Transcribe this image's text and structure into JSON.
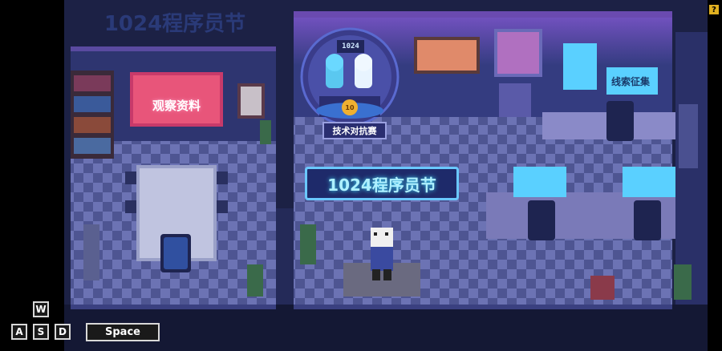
{
  "scene": {
    "top_watermark": "1024程序员节",
    "sign_observe": "观察资料",
    "sign_clues": "线索征集",
    "banner_main": "1024程序员节",
    "sign_tech_battle": "技术对抗赛",
    "trophy_label": "1024",
    "coin_label": "10"
  },
  "controls": {
    "keys": [
      "W",
      "A",
      "S",
      "D"
    ],
    "space_label": "Space",
    "help_label": "?"
  },
  "colors": {
    "floor_dark": "#4a4f8a",
    "floor_light": "#6a70b0",
    "wall": "#262c5a",
    "neon_pink": "#ff5fa0",
    "neon_cyan": "#40e0ff"
  }
}
